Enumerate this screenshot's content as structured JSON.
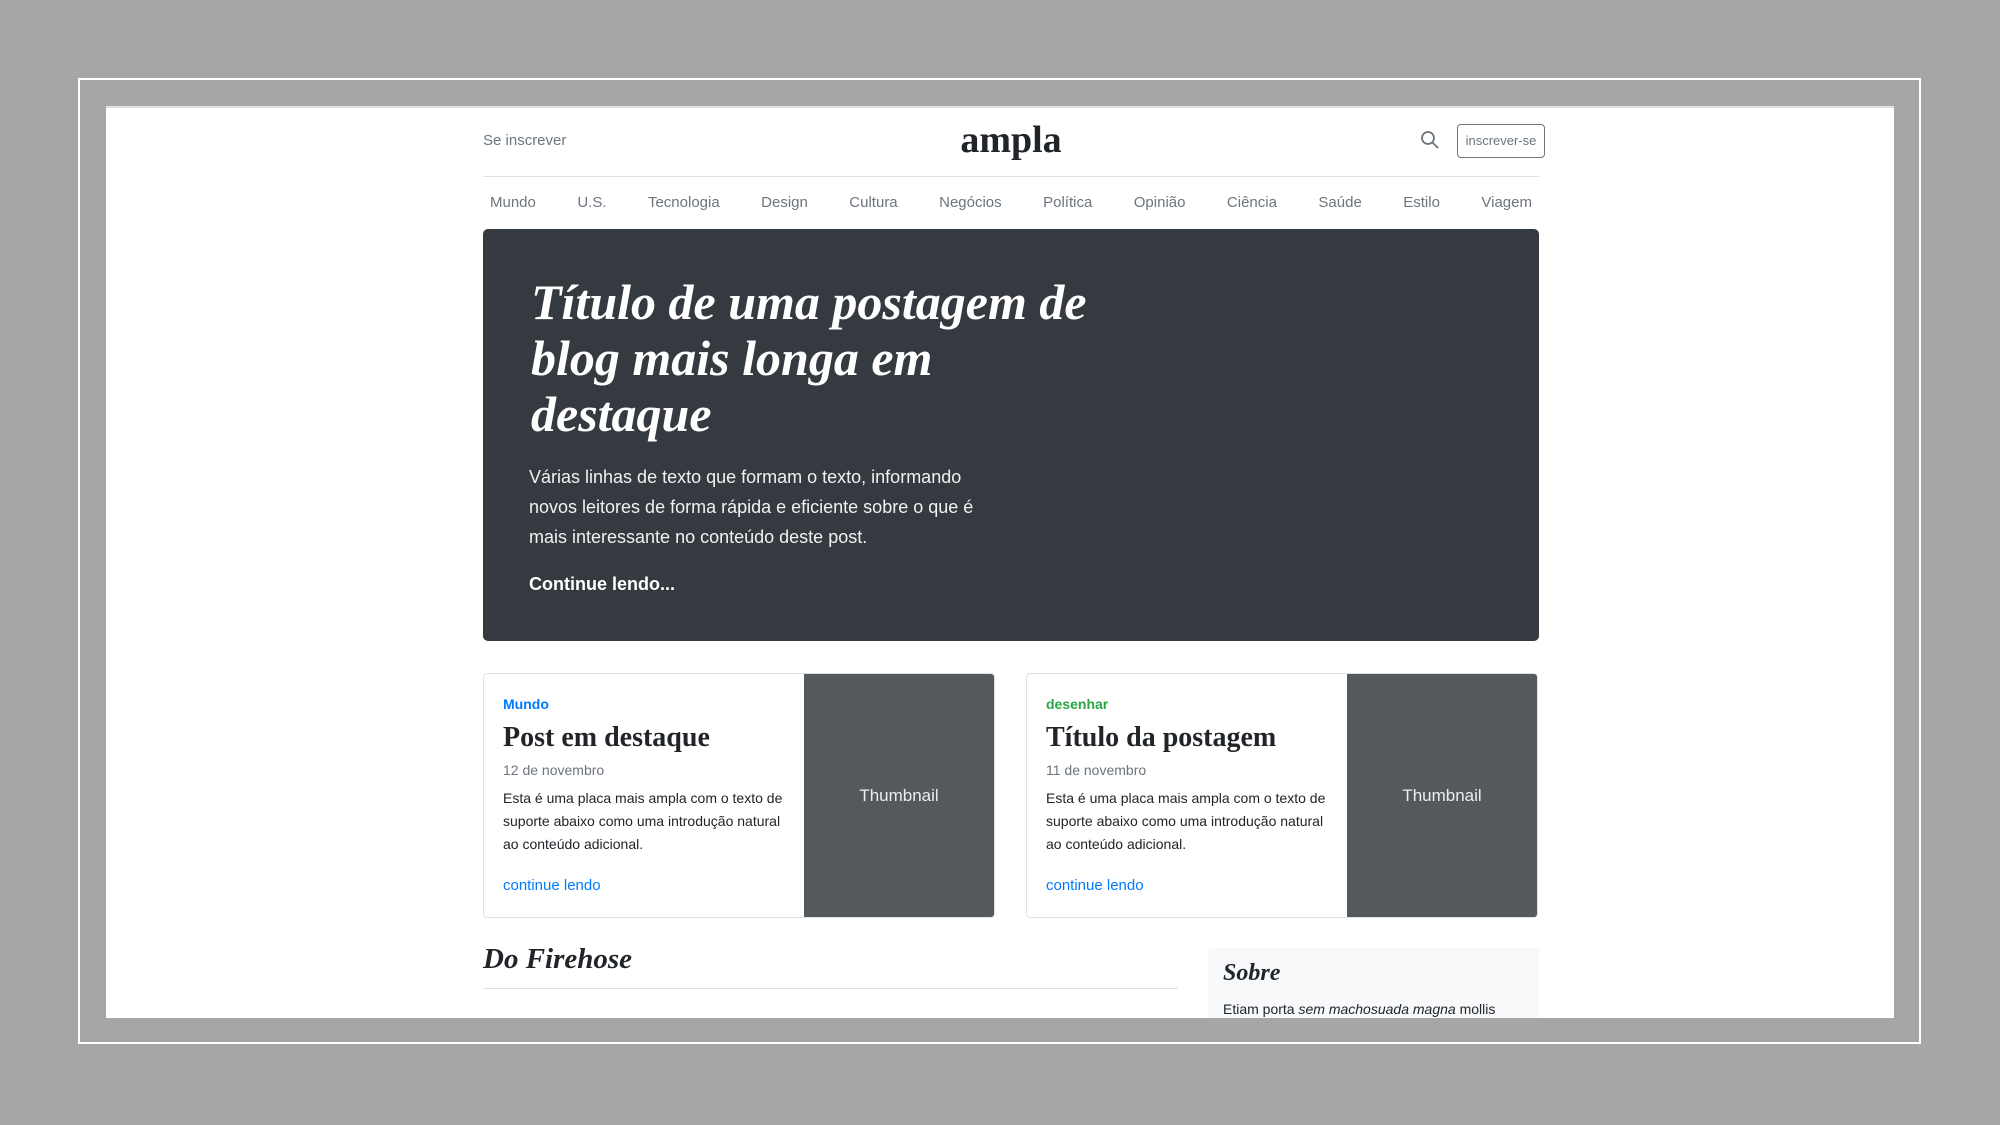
{
  "header": {
    "subscribe_link": "Se inscrever",
    "logo": "ampla",
    "signup_button": "inscrever-se",
    "search_icon": "search-icon"
  },
  "nav": {
    "items": [
      "Mundo",
      "U.S.",
      "Tecnologia",
      "Design",
      "Cultura",
      "Negócios",
      "Política",
      "Opinião",
      "Ciência",
      "Saúde",
      "Estilo",
      "Viagem"
    ]
  },
  "hero": {
    "title": "Título de uma postagem de blog mais longa em destaque",
    "lead": "Várias linhas de texto que formam o texto, informando novos leitores de forma rápida e eficiente sobre o que é mais interessante no conteúdo deste post.",
    "link": "Continue lendo..."
  },
  "cards": [
    {
      "category": "Mundo",
      "category_color": "#007bff",
      "title": "Post em destaque",
      "date": "12 de novembro",
      "text": "Esta é uma placa mais ampla com o texto de suporte abaixo como uma introdução natural ao conteúdo adicional.",
      "link": "continue lendo",
      "thumbnail": "Thumbnail"
    },
    {
      "category": "desenhar",
      "category_color": "#28a745",
      "title": "Título da postagem",
      "date": "11 de novembro",
      "text": "Esta é uma placa mais ampla com o texto de suporte abaixo como uma introdução natural ao conteúdo adicional.",
      "link": "continue lendo",
      "thumbnail": "Thumbnail"
    }
  ],
  "main": {
    "section_title": "Do Firehose"
  },
  "sidebar": {
    "about_title": "Sobre",
    "about_text_start": "Etiam porta ",
    "about_text_em": "sem machosuada magna",
    "about_text_end": " mollis"
  },
  "colors": {
    "hero_bg": "#343a40",
    "thumb_bg": "#55595c",
    "link": "#007bff"
  }
}
